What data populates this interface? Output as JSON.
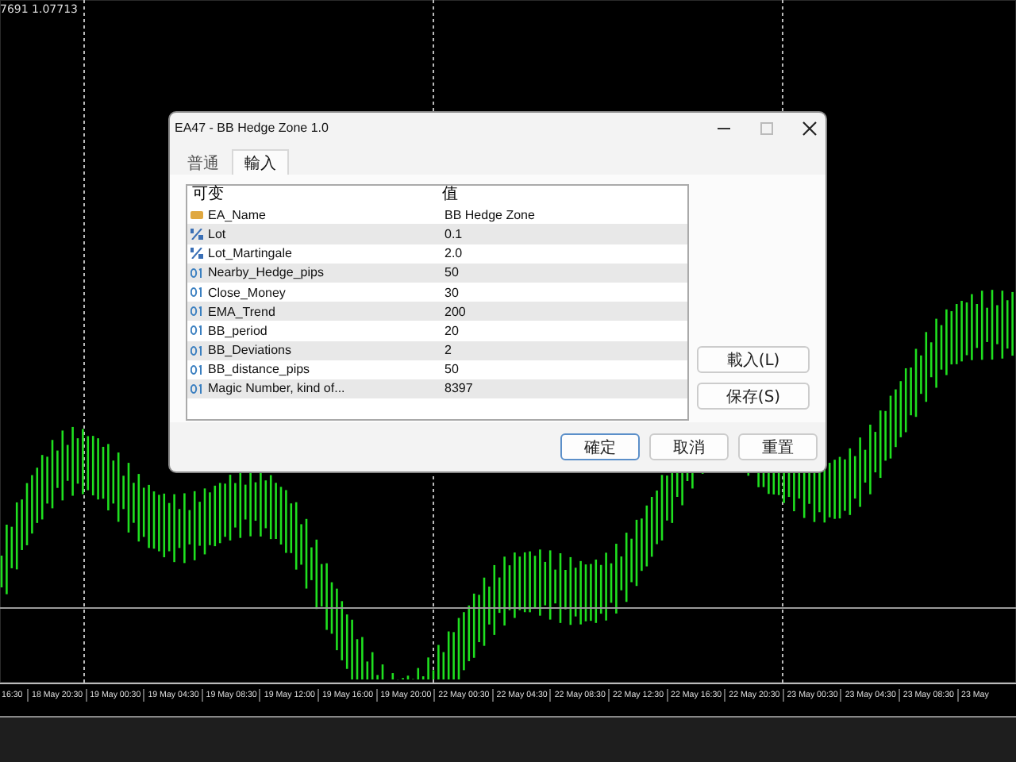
{
  "chart": {
    "price_label": "7691 1.07713",
    "time_axis": [
      "16:30",
      "18 May 20:30",
      "19 May 00:30",
      "19 May 04:30",
      "19 May 08:30",
      "19 May 12:00",
      "19 May 16:00",
      "19 May 20:00",
      "22 May 00:30",
      "22 May 04:30",
      "22 May 08:30",
      "22 May 12:30",
      "22 May 16:30",
      "22 May 20:30",
      "23 May 00:30",
      "23 May 04:30",
      "23 May 08:30",
      "23 May"
    ]
  },
  "dialog": {
    "title": "EA47 - BB Hedge Zone 1.0",
    "tabs": [
      {
        "label": "普通",
        "selected": false
      },
      {
        "label": "輸入",
        "selected": true
      }
    ],
    "columns": [
      "可变",
      "值"
    ],
    "rows": [
      {
        "kind": "string",
        "name": "EA_Name",
        "value": "BB Hedge Zone"
      },
      {
        "kind": "double",
        "name": "Lot",
        "value": "0.1"
      },
      {
        "kind": "double",
        "name": "Lot_Martingale",
        "value": "2.0"
      },
      {
        "kind": "int",
        "name": "Nearby_Hedge_pips",
        "value": "50"
      },
      {
        "kind": "int",
        "name": "Close_Money",
        "value": "30"
      },
      {
        "kind": "int",
        "name": "EMA_Trend",
        "value": "200"
      },
      {
        "kind": "int",
        "name": "BB_period",
        "value": "20"
      },
      {
        "kind": "int",
        "name": "BB_Deviations",
        "value": "2"
      },
      {
        "kind": "int",
        "name": "BB_distance_pips",
        "value": "50"
      },
      {
        "kind": "int",
        "name": "Magic Number, kind of...",
        "value": "8397"
      }
    ],
    "side_buttons": [
      "載入(L)",
      "保存(S)"
    ],
    "buttons": [
      {
        "label": "確定",
        "default": true
      },
      {
        "label": "取消",
        "default": false
      },
      {
        "label": "重置",
        "default": false
      }
    ]
  }
}
